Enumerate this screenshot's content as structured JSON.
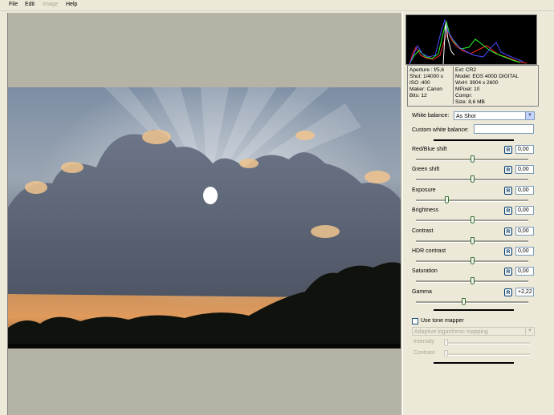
{
  "menu": [
    "File",
    "Edit",
    "Image",
    "Help"
  ],
  "menu_disabled": [
    false,
    false,
    true,
    false
  ],
  "info": {
    "left": [
      "Aperture : f/5,6",
      "Shut: 1/4000 s",
      "ISO :400",
      "Maker: Canon",
      "Bits: 12"
    ],
    "right": [
      "Ext: CR2",
      "Model: EOS 400D DIGITAL",
      "WxH: 3904 x 2600",
      "MPixel: 10",
      "Compr:",
      "Size: 8,6 MB"
    ]
  },
  "white_balance": {
    "label": "White balance:",
    "value": "As Shot"
  },
  "custom_white_balance": {
    "label": "Custom white balance:",
    "value": ""
  },
  "sliders": [
    {
      "label": "Red/Blue shift",
      "value": "0,00",
      "level": 0.5
    },
    {
      "label": "Green shift",
      "value": "0,00",
      "level": 0.5
    },
    {
      "label": "Exposure",
      "value": "0,00",
      "level": 0.27
    },
    {
      "label": "Brightness",
      "value": "0,00",
      "level": 0.5
    },
    {
      "label": "Contrast",
      "value": "0,00",
      "level": 0.5
    },
    {
      "label": "HDR contrast",
      "value": "0,00",
      "level": 0.5
    },
    {
      "label": "Saturation",
      "value": "0,00",
      "level": 0.5
    },
    {
      "label": "Gamma",
      "value": "+2,22",
      "level": 0.42
    }
  ],
  "reset_label": "R",
  "tone_mapper": {
    "checkbox_label": "Use tone mapper",
    "checked": false,
    "method": "Adaptive logarithmic mapping",
    "intensity_label": "Intensity",
    "contrast_label": "Contrast"
  },
  "colors": {
    "canvas": "#b4b3a6",
    "panel": "#ece9d8",
    "accent": "#7f9db9"
  }
}
